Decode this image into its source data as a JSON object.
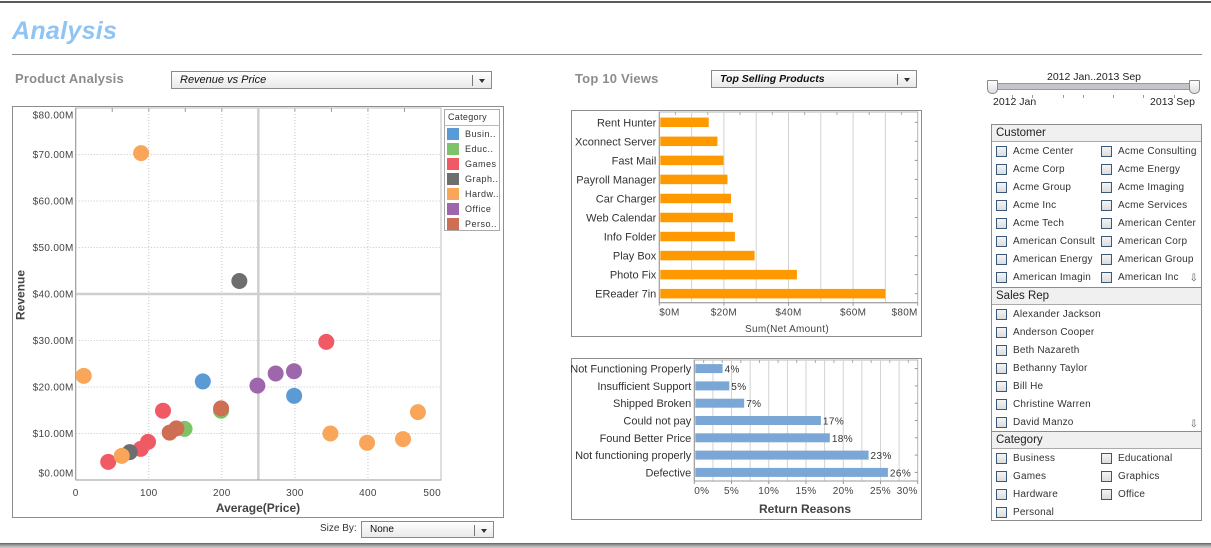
{
  "page": {
    "title": "Analysis"
  },
  "product_analysis": {
    "label": "Product Analysis",
    "view_select": {
      "value": "Revenue vs Price"
    },
    "size_by": {
      "label": "Size By:",
      "value": "None"
    }
  },
  "top_views": {
    "label": "Top 10 Views",
    "view_select": {
      "value": "Top Selling Products"
    }
  },
  "date_slider": {
    "range_label": "2012 Jan..2013 Sep",
    "min_label": "2012 Jan",
    "max_label": "2013 Sep",
    "selection_fraction": [
      0,
      1
    ]
  },
  "filters": {
    "customer": {
      "title": "Customer",
      "scroll_icon": "scroll-down-icon",
      "items": [
        "Acme Center",
        "Acme Consulting",
        "Acme Corp",
        "Acme Energy",
        "Acme Group",
        "Acme Imaging",
        "Acme Inc",
        "Acme Services",
        "Acme Tech",
        "American Center",
        "American Consult",
        "American Corp",
        "American Energy",
        "American Group",
        "American Imagin",
        "American Inc"
      ]
    },
    "sales_rep": {
      "title": "Sales Rep",
      "scroll_icon": "scroll-down-icon",
      "items": [
        "Alexander Jackson",
        "Anderson Cooper",
        "Beth Nazareth",
        "Bethanny Taylor",
        "Bill He",
        "Christine Warren",
        "David Manzo"
      ]
    },
    "category": {
      "title": "Category",
      "items": [
        "Business",
        "Educational",
        "Games",
        "Graphics",
        "Hardware",
        "Office",
        "Personal"
      ]
    }
  },
  "chart_data": [
    {
      "type": "scatter",
      "title": "Revenue vs Price",
      "xlabel": "Average(Price)",
      "ylabel": "Revenue",
      "x_range": [
        0,
        500
      ],
      "y_range": [
        0,
        80
      ],
      "x_ticks": [
        0,
        100,
        200,
        300,
        400,
        500
      ],
      "x_tick_labels": [
        "0",
        "100",
        "200",
        "300",
        "400",
        "500"
      ],
      "y_ticks": [
        0,
        10,
        20,
        30,
        40,
        50,
        60,
        70,
        80
      ],
      "y_tick_labels": [
        "$0.00M",
        "$10.00M",
        "$20.00M",
        "$30.00M",
        "$40.00M",
        "$50.00M",
        "$60.00M",
        "$70.00M",
        "$80.00M"
      ],
      "y_unit": "$M",
      "grid": true,
      "reference_lines": {
        "x": 250,
        "y": 40
      },
      "legend": {
        "title": "Category",
        "position": "top-right",
        "entries": [
          {
            "label": "Busin..",
            "series": "Business"
          },
          {
            "label": "Educ..",
            "series": "Educational"
          },
          {
            "label": "Games",
            "series": "Games"
          },
          {
            "label": "Graph..",
            "series": "Graphics"
          },
          {
            "label": "Hardw..",
            "series": "Hardware"
          },
          {
            "label": "Office",
            "series": "Office"
          },
          {
            "label": "Perso..",
            "series": "Personal"
          }
        ]
      },
      "series": [
        {
          "name": "Business",
          "color": "#5B9BD5",
          "points": [
            [
              174,
              21.2
            ],
            [
              299,
              18.1
            ]
          ]
        },
        {
          "name": "Educational",
          "color": "#7CC36A",
          "points": [
            [
              199,
              14.9
            ],
            [
              149,
              11.0
            ]
          ]
        },
        {
          "name": "Games",
          "color": "#F05A64",
          "points": [
            [
              119.5,
              14.9
            ],
            [
              99,
              8.2
            ],
            [
              89,
              6.7
            ],
            [
              44.5,
              3.9
            ],
            [
              343,
              29.7
            ]
          ]
        },
        {
          "name": "Graphics",
          "color": "#6E6E6E",
          "points": [
            [
              224,
              42.8
            ],
            [
              74,
              6.0
            ]
          ]
        },
        {
          "name": "Hardware",
          "color": "#F9A65A",
          "points": [
            [
              11,
              22.4
            ],
            [
              89.5,
              70.3
            ],
            [
              63,
              5.2
            ],
            [
              348.7,
              10.0
            ],
            [
              398.8,
              8.0
            ],
            [
              448,
              8.8
            ],
            [
              468.4,
              14.6
            ]
          ]
        },
        {
          "name": "Office",
          "color": "#9E66AB",
          "points": [
            [
              248.7,
              20.3
            ],
            [
              273.7,
              22.9
            ],
            [
              298.8,
              23.4
            ]
          ]
        },
        {
          "name": "Personal",
          "color": "#CE6E53",
          "points": [
            [
              199,
              15.4
            ],
            [
              128.6,
              10.2
            ],
            [
              137.8,
              11.1
            ]
          ]
        }
      ]
    },
    {
      "type": "bar",
      "orientation": "horizontal",
      "title": "Top Selling Products",
      "categories": [
        "Rent Hunter",
        "Xconnect Server",
        "Fast Mail",
        "Payroll Manager",
        "Car Charger",
        "Web Calendar",
        "Info Folder",
        "Play Box",
        "Photo Fix",
        "EReader 7in"
      ],
      "values": [
        15.3,
        18.0,
        19.9,
        21.1,
        22.2,
        22.8,
        23.4,
        29.5,
        42.6,
        70.0
      ],
      "unit": "$M",
      "xlabel": "Sum(Net Amount)",
      "ylabel": "",
      "x_range": [
        0,
        80
      ],
      "x_ticks": [
        0,
        20,
        40,
        60,
        80
      ],
      "x_tick_labels": [
        "$0M",
        "$20M",
        "$40M",
        "$60M",
        "$80M"
      ],
      "grid": true,
      "color": "#FF9900"
    },
    {
      "type": "bar",
      "orientation": "horizontal",
      "title": "Return Reasons",
      "categories": [
        "Not Functioning Properly",
        "Insufficient Support",
        "Shipped Broken",
        "Could not pay",
        "Found Better Price",
        "Not functioning properly",
        "Defective"
      ],
      "values": [
        3.8,
        4.7,
        6.7,
        17.0,
        18.2,
        23.4,
        26.0
      ],
      "data_labels": [
        "4%",
        "5%",
        "7%",
        "17%",
        "18%",
        "23%",
        "26%"
      ],
      "unit": "%",
      "xlabel": "Return Reasons",
      "ylabel": "",
      "x_range": [
        0,
        30
      ],
      "x_ticks": [
        0,
        5,
        10,
        15,
        20,
        25,
        30
      ],
      "x_tick_labels": [
        "0%",
        "5%",
        "10%",
        "15%",
        "20%",
        "25%",
        "30%"
      ],
      "grid": true,
      "color": "#7BA7D6"
    }
  ]
}
